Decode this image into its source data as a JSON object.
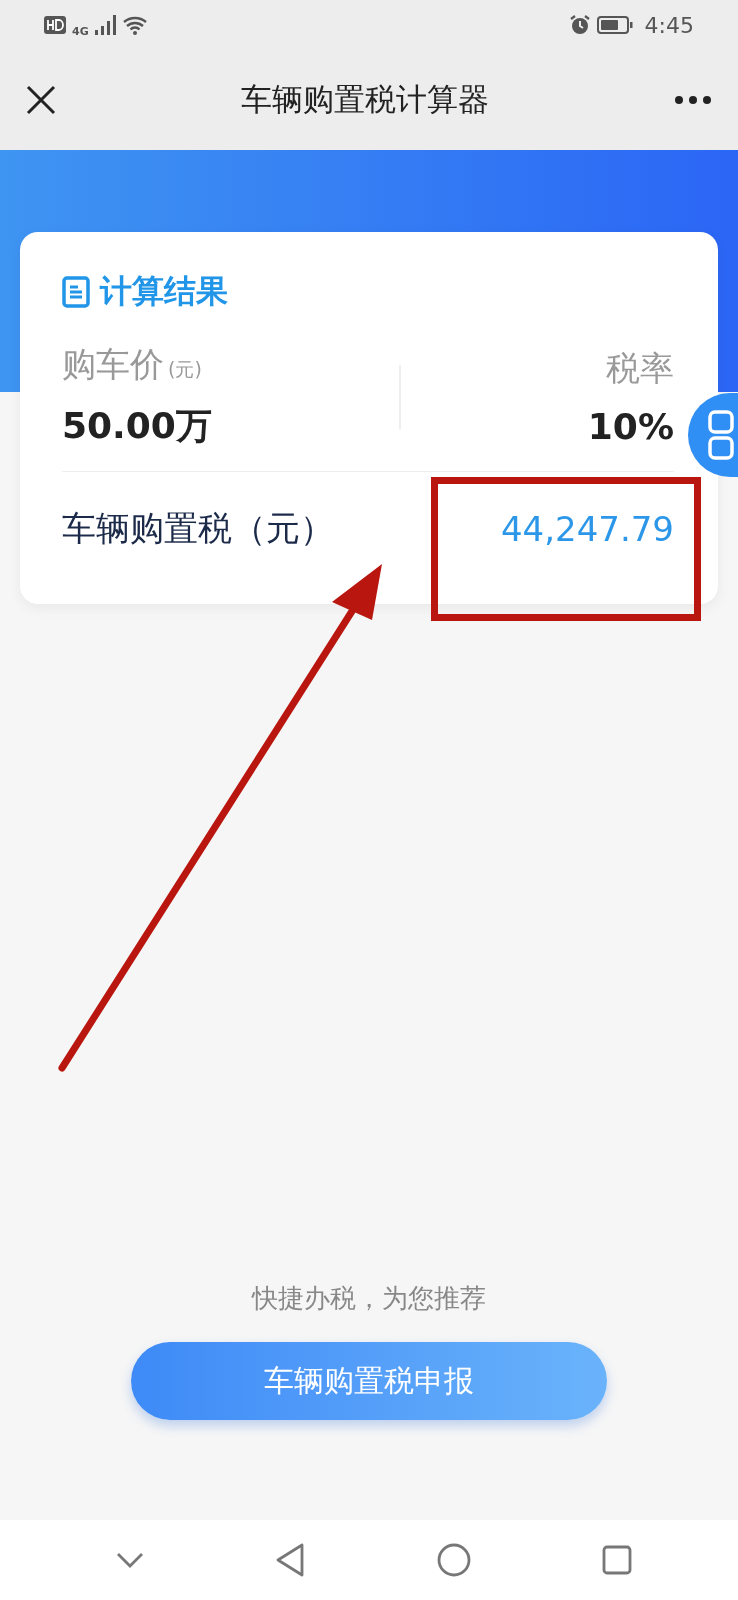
{
  "status_bar": {
    "network": "4G",
    "time": "4:45"
  },
  "title_bar": {
    "title": "车辆购置税计算器"
  },
  "result_card": {
    "heading": "计算结果",
    "price": {
      "label": "购车价",
      "unit": "(元)",
      "value": "50.00万"
    },
    "rate": {
      "label": "税率",
      "value": "10%"
    },
    "tax": {
      "label": "车辆购置税（元）",
      "value": "44,247.79"
    }
  },
  "recommend": {
    "hint": "快捷办税，为您推荐",
    "button": "车辆购置税申报"
  }
}
